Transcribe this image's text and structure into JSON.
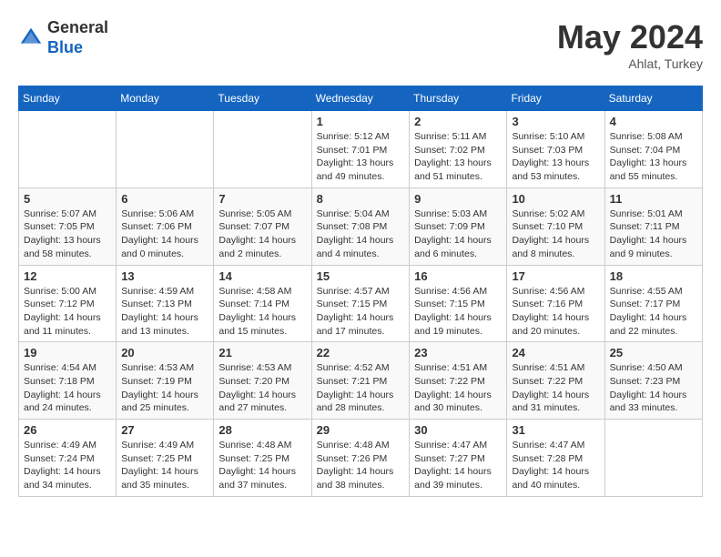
{
  "header": {
    "logo_general": "General",
    "logo_blue": "Blue",
    "month_title": "May 2024",
    "location": "Ahlat, Turkey"
  },
  "weekdays": [
    "Sunday",
    "Monday",
    "Tuesday",
    "Wednesday",
    "Thursday",
    "Friday",
    "Saturday"
  ],
  "weeks": [
    [
      null,
      null,
      null,
      {
        "day": "1",
        "sunrise": "Sunrise: 5:12 AM",
        "sunset": "Sunset: 7:01 PM",
        "daylight": "Daylight: 13 hours and 49 minutes."
      },
      {
        "day": "2",
        "sunrise": "Sunrise: 5:11 AM",
        "sunset": "Sunset: 7:02 PM",
        "daylight": "Daylight: 13 hours and 51 minutes."
      },
      {
        "day": "3",
        "sunrise": "Sunrise: 5:10 AM",
        "sunset": "Sunset: 7:03 PM",
        "daylight": "Daylight: 13 hours and 53 minutes."
      },
      {
        "day": "4",
        "sunrise": "Sunrise: 5:08 AM",
        "sunset": "Sunset: 7:04 PM",
        "daylight": "Daylight: 13 hours and 55 minutes."
      }
    ],
    [
      {
        "day": "5",
        "sunrise": "Sunrise: 5:07 AM",
        "sunset": "Sunset: 7:05 PM",
        "daylight": "Daylight: 13 hours and 58 minutes."
      },
      {
        "day": "6",
        "sunrise": "Sunrise: 5:06 AM",
        "sunset": "Sunset: 7:06 PM",
        "daylight": "Daylight: 14 hours and 0 minutes."
      },
      {
        "day": "7",
        "sunrise": "Sunrise: 5:05 AM",
        "sunset": "Sunset: 7:07 PM",
        "daylight": "Daylight: 14 hours and 2 minutes."
      },
      {
        "day": "8",
        "sunrise": "Sunrise: 5:04 AM",
        "sunset": "Sunset: 7:08 PM",
        "daylight": "Daylight: 14 hours and 4 minutes."
      },
      {
        "day": "9",
        "sunrise": "Sunrise: 5:03 AM",
        "sunset": "Sunset: 7:09 PM",
        "daylight": "Daylight: 14 hours and 6 minutes."
      },
      {
        "day": "10",
        "sunrise": "Sunrise: 5:02 AM",
        "sunset": "Sunset: 7:10 PM",
        "daylight": "Daylight: 14 hours and 8 minutes."
      },
      {
        "day": "11",
        "sunrise": "Sunrise: 5:01 AM",
        "sunset": "Sunset: 7:11 PM",
        "daylight": "Daylight: 14 hours and 9 minutes."
      }
    ],
    [
      {
        "day": "12",
        "sunrise": "Sunrise: 5:00 AM",
        "sunset": "Sunset: 7:12 PM",
        "daylight": "Daylight: 14 hours and 11 minutes."
      },
      {
        "day": "13",
        "sunrise": "Sunrise: 4:59 AM",
        "sunset": "Sunset: 7:13 PM",
        "daylight": "Daylight: 14 hours and 13 minutes."
      },
      {
        "day": "14",
        "sunrise": "Sunrise: 4:58 AM",
        "sunset": "Sunset: 7:14 PM",
        "daylight": "Daylight: 14 hours and 15 minutes."
      },
      {
        "day": "15",
        "sunrise": "Sunrise: 4:57 AM",
        "sunset": "Sunset: 7:15 PM",
        "daylight": "Daylight: 14 hours and 17 minutes."
      },
      {
        "day": "16",
        "sunrise": "Sunrise: 4:56 AM",
        "sunset": "Sunset: 7:15 PM",
        "daylight": "Daylight: 14 hours and 19 minutes."
      },
      {
        "day": "17",
        "sunrise": "Sunrise: 4:56 AM",
        "sunset": "Sunset: 7:16 PM",
        "daylight": "Daylight: 14 hours and 20 minutes."
      },
      {
        "day": "18",
        "sunrise": "Sunrise: 4:55 AM",
        "sunset": "Sunset: 7:17 PM",
        "daylight": "Daylight: 14 hours and 22 minutes."
      }
    ],
    [
      {
        "day": "19",
        "sunrise": "Sunrise: 4:54 AM",
        "sunset": "Sunset: 7:18 PM",
        "daylight": "Daylight: 14 hours and 24 minutes."
      },
      {
        "day": "20",
        "sunrise": "Sunrise: 4:53 AM",
        "sunset": "Sunset: 7:19 PM",
        "daylight": "Daylight: 14 hours and 25 minutes."
      },
      {
        "day": "21",
        "sunrise": "Sunrise: 4:53 AM",
        "sunset": "Sunset: 7:20 PM",
        "daylight": "Daylight: 14 hours and 27 minutes."
      },
      {
        "day": "22",
        "sunrise": "Sunrise: 4:52 AM",
        "sunset": "Sunset: 7:21 PM",
        "daylight": "Daylight: 14 hours and 28 minutes."
      },
      {
        "day": "23",
        "sunrise": "Sunrise: 4:51 AM",
        "sunset": "Sunset: 7:22 PM",
        "daylight": "Daylight: 14 hours and 30 minutes."
      },
      {
        "day": "24",
        "sunrise": "Sunrise: 4:51 AM",
        "sunset": "Sunset: 7:22 PM",
        "daylight": "Daylight: 14 hours and 31 minutes."
      },
      {
        "day": "25",
        "sunrise": "Sunrise: 4:50 AM",
        "sunset": "Sunset: 7:23 PM",
        "daylight": "Daylight: 14 hours and 33 minutes."
      }
    ],
    [
      {
        "day": "26",
        "sunrise": "Sunrise: 4:49 AM",
        "sunset": "Sunset: 7:24 PM",
        "daylight": "Daylight: 14 hours and 34 minutes."
      },
      {
        "day": "27",
        "sunrise": "Sunrise: 4:49 AM",
        "sunset": "Sunset: 7:25 PM",
        "daylight": "Daylight: 14 hours and 35 minutes."
      },
      {
        "day": "28",
        "sunrise": "Sunrise: 4:48 AM",
        "sunset": "Sunset: 7:25 PM",
        "daylight": "Daylight: 14 hours and 37 minutes."
      },
      {
        "day": "29",
        "sunrise": "Sunrise: 4:48 AM",
        "sunset": "Sunset: 7:26 PM",
        "daylight": "Daylight: 14 hours and 38 minutes."
      },
      {
        "day": "30",
        "sunrise": "Sunrise: 4:47 AM",
        "sunset": "Sunset: 7:27 PM",
        "daylight": "Daylight: 14 hours and 39 minutes."
      },
      {
        "day": "31",
        "sunrise": "Sunrise: 4:47 AM",
        "sunset": "Sunset: 7:28 PM",
        "daylight": "Daylight: 14 hours and 40 minutes."
      },
      null
    ]
  ]
}
